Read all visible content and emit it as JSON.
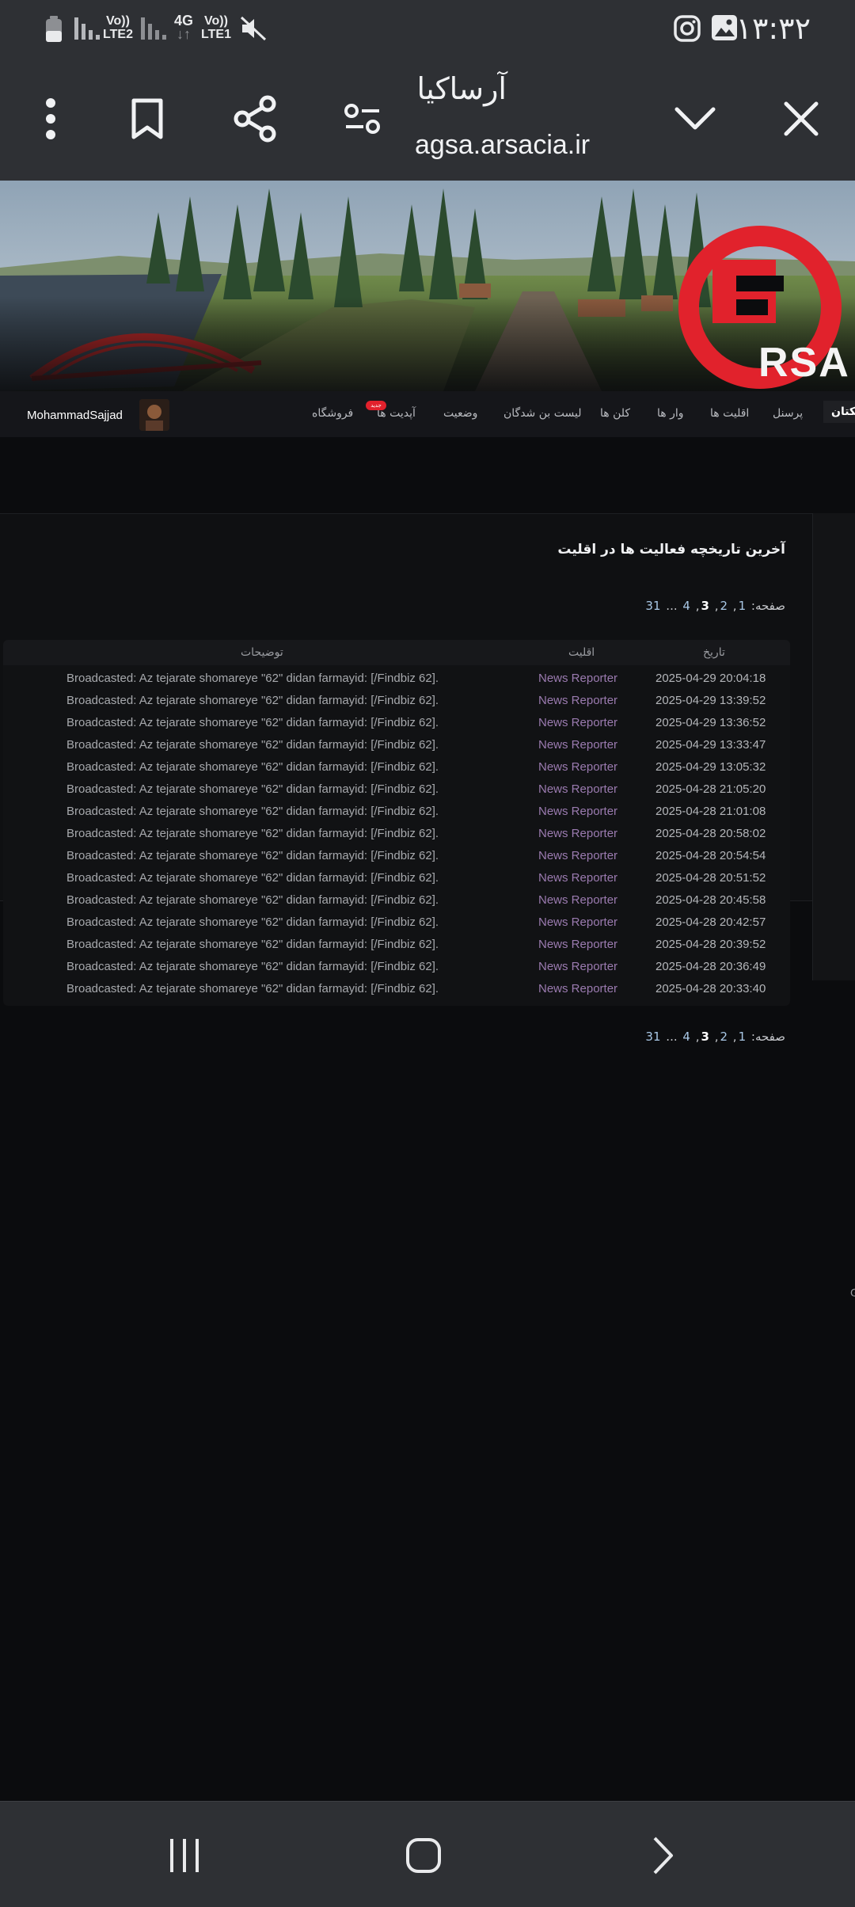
{
  "status_bar": {
    "clock": "۱۳:۳۲",
    "sim2_label_top": "Vo))",
    "sim2_label_bottom": "LTE2",
    "net_label_top": "4G",
    "net_label_bottom": "↓↑",
    "sim1_label_top": "Vo))",
    "sim1_label_bottom": "LTE1",
    "icons": [
      "battery-icon",
      "signal-icon",
      "mute-icon",
      "instagram-icon",
      "gallery-icon"
    ]
  },
  "browser": {
    "title": "آرساکیا",
    "url": "agsa.arsacia.ir"
  },
  "site": {
    "nav_items": [
      "ریکتان",
      "پرسنل",
      "اقلیت ها",
      "وار ها",
      "کلن ها",
      "لیست بن شدگان",
      "وضعیت",
      "آپدیت ها",
      "فروشگاه"
    ],
    "new_badge": "جدید",
    "username": "MohammadSajjad",
    "section_title": "آخرین تاریخچه فعالیت ها در اقلیت",
    "pagination": {
      "label": "صفحه:",
      "pages": [
        "1",
        "2",
        "3",
        "4",
        "...",
        "31"
      ],
      "current": "3"
    },
    "table": {
      "headers": {
        "date": "تاریخ",
        "faction": "اقلیت",
        "description": "توضیحات"
      },
      "rows": [
        {
          "date": "2025-04-29 20:04:18",
          "faction": "News Reporter",
          "description": "Broadcasted: Az tejarate shomareye \"62\" didan farmayid: [/Findbiz 62]."
        },
        {
          "date": "2025-04-29 13:39:52",
          "faction": "News Reporter",
          "description": "Broadcasted: Az tejarate shomareye \"62\" didan farmayid: [/Findbiz 62]."
        },
        {
          "date": "2025-04-29 13:36:52",
          "faction": "News Reporter",
          "description": "Broadcasted: Az tejarate shomareye \"62\" didan farmayid: [/Findbiz 62]."
        },
        {
          "date": "2025-04-29 13:33:47",
          "faction": "News Reporter",
          "description": "Broadcasted: Az tejarate shomareye \"62\" didan farmayid: [/Findbiz 62]."
        },
        {
          "date": "2025-04-29 13:05:32",
          "faction": "News Reporter",
          "description": "Broadcasted: Az tejarate shomareye \"62\" didan farmayid: [/Findbiz 62]."
        },
        {
          "date": "2025-04-28 21:05:20",
          "faction": "News Reporter",
          "description": "Broadcasted: Az tejarate shomareye \"62\" didan farmayid: [/Findbiz 62]."
        },
        {
          "date": "2025-04-28 21:01:08",
          "faction": "News Reporter",
          "description": "Broadcasted: Az tejarate shomareye \"62\" didan farmayid: [/Findbiz 62]."
        },
        {
          "date": "2025-04-28 20:58:02",
          "faction": "News Reporter",
          "description": "Broadcasted: Az tejarate shomareye \"62\" didan farmayid: [/Findbiz 62]."
        },
        {
          "date": "2025-04-28 20:54:54",
          "faction": "News Reporter",
          "description": "Broadcasted: Az tejarate shomareye \"62\" didan farmayid: [/Findbiz 62]."
        },
        {
          "date": "2025-04-28 20:51:52",
          "faction": "News Reporter",
          "description": "Broadcasted: Az tejarate shomareye \"62\" didan farmayid: [/Findbiz 62]."
        },
        {
          "date": "2025-04-28 20:45:58",
          "faction": "News Reporter",
          "description": "Broadcasted: Az tejarate shomareye \"62\" didan farmayid: [/Findbiz 62]."
        },
        {
          "date": "2025-04-28 20:42:57",
          "faction": "News Reporter",
          "description": "Broadcasted: Az tejarate shomareye \"62\" didan farmayid: [/Findbiz 62]."
        },
        {
          "date": "2025-04-28 20:39:52",
          "faction": "News Reporter",
          "description": "Broadcasted: Az tejarate shomareye \"62\" didan farmayid: [/Findbiz 62]."
        },
        {
          "date": "2025-04-28 20:36:49",
          "faction": "News Reporter",
          "description": "Broadcasted: Az tejarate shomareye \"62\" didan farmayid: [/Findbiz 62]."
        },
        {
          "date": "2025-04-28 20:33:40",
          "faction": "News Reporter",
          "description": "Broadcasted: Az tejarate shomareye \"62\" didan farmayid: [/Findbiz 62]."
        }
      ]
    },
    "side_text": "G",
    "logo_text": "RSA"
  },
  "colors": {
    "bar_bg": "#2e3034",
    "page_bg": "#0b0c0e",
    "faction_link": "#9b7bb0",
    "page_link": "#a9c8e6",
    "logo_red": "#e1222c",
    "badge_red": "#e2212c"
  }
}
